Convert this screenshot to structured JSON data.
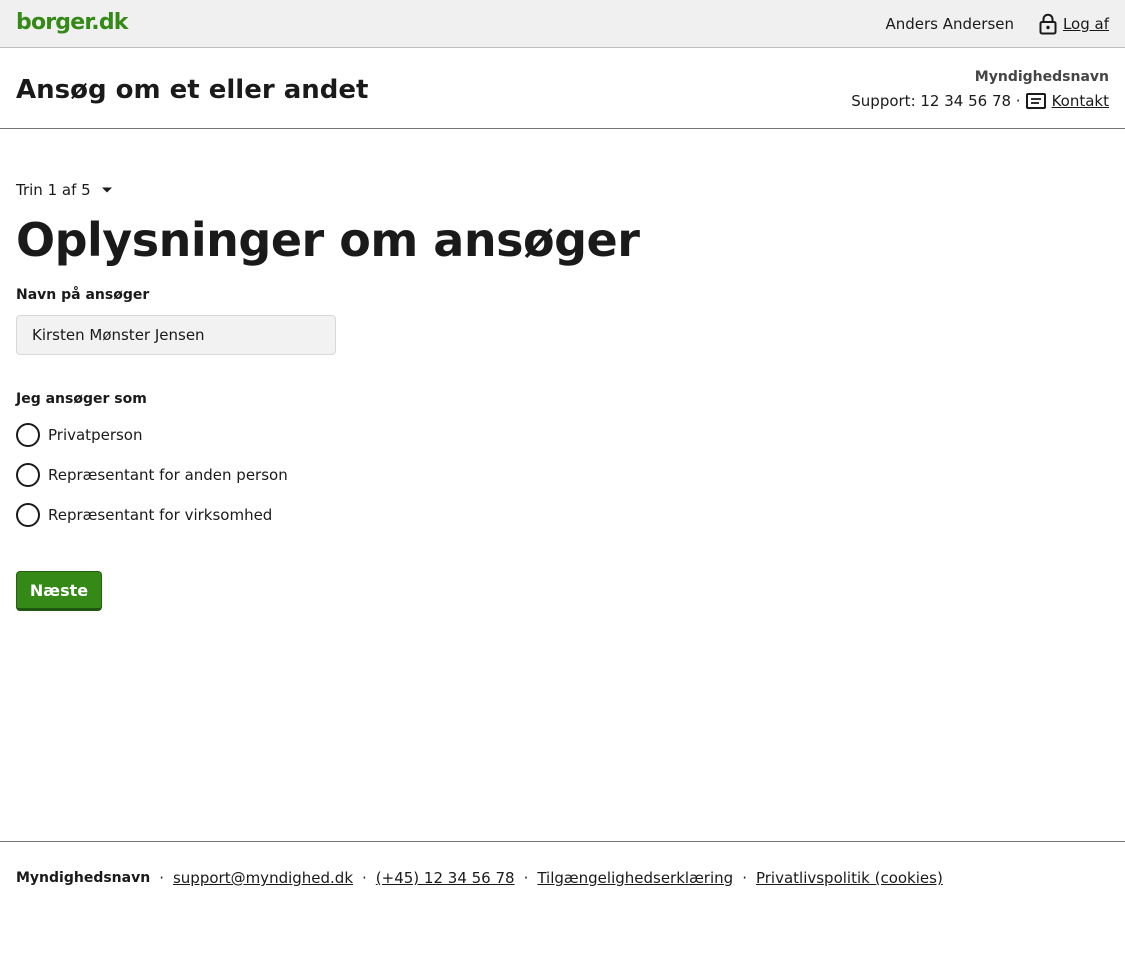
{
  "portal_header": {
    "logo": "borger.dk",
    "user_name": "Anders Andersen",
    "logout_label": "Log af",
    "logout_icon": "lock-icon"
  },
  "solution_header": {
    "title": "Ansøg om et eller andet",
    "authority": "Myndighedsnavn",
    "support_text": "Support: 12 34 56 78 ·",
    "contact_label": "Kontakt",
    "contact_icon": "message-icon"
  },
  "main": {
    "step_indicator": "Trin 1 af 5",
    "page_title": "Oplysninger om ansøger",
    "name_field": {
      "label": "Navn på ansøger",
      "value": "Kirsten Mønster Jensen"
    },
    "applicant_type": {
      "legend": "Jeg ansøger som",
      "options": [
        {
          "label": "Privatperson",
          "selected": false
        },
        {
          "label": "Repræsentant for anden person",
          "selected": false
        },
        {
          "label": "Repræsentant for virksomhed",
          "selected": false
        }
      ]
    },
    "next_button": "Næste"
  },
  "footer": {
    "org": "Myndighedsnavn",
    "separator": "·",
    "links": [
      "support@myndighed.dk",
      "(+45) 12 34 56 78",
      "Tilgængelighedserklæring",
      "Privatlivspolitik (cookies)"
    ]
  },
  "colors": {
    "brand_green": "#358917",
    "header_bg": "#f0f0f0",
    "text": "#1a1a1a"
  }
}
